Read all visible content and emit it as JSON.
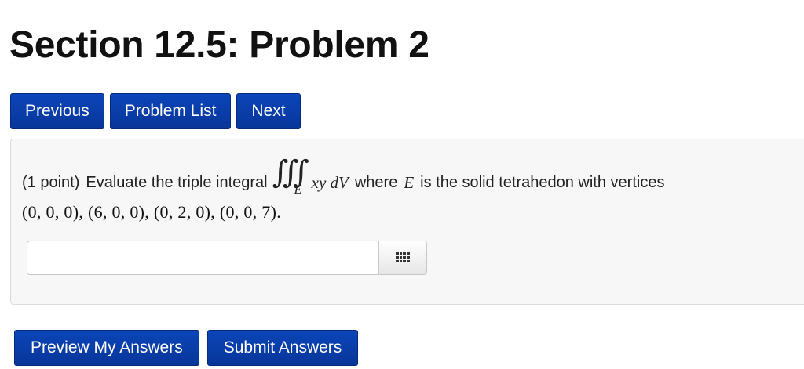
{
  "page": {
    "title": "Section 12.5: Problem 2"
  },
  "nav": {
    "previous_label": "Previous",
    "problem_list_label": "Problem List",
    "next_label": "Next"
  },
  "problem": {
    "points": "(1 point)",
    "text_before_integral": "Evaluate the triple integral",
    "integral_symbol": "∭",
    "integral_subscript": "E",
    "integrand": "xy dV",
    "text_where": "where",
    "region_var": "E",
    "text_after": "is the solid tetrahedon with vertices",
    "vertices": "(0, 0, 0), (6, 0, 0), (0, 2, 0), (0, 0, 7)."
  },
  "answer": {
    "value": "",
    "placeholder": "",
    "keypad_icon": "grid-keypad-icon"
  },
  "footer": {
    "preview_label": "Preview My Answers",
    "submit_label": "Submit Answers"
  },
  "colors": {
    "button_bg": "#0a3fa8",
    "panel_bg": "#f7f7f7"
  }
}
